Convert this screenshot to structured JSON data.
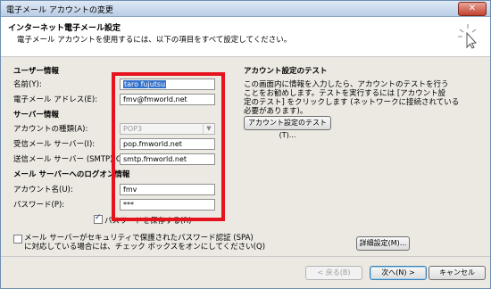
{
  "window": {
    "title": "電子メール アカウントの変更",
    "close_label": "✕"
  },
  "header": {
    "title": "インターネット電子メール設定",
    "subtitle": "電子メール アカウントを使用するには、以下の項目をすべて設定してください。"
  },
  "user_info": {
    "heading": "ユーザー情報",
    "name_label": "名前(Y):",
    "name_value": "taro fujutsu",
    "email_label": "電子メール アドレス(E):",
    "email_value": "fmv@fmworld.net"
  },
  "server_info": {
    "heading": "サーバー情報",
    "account_type_label": "アカウントの種類(A):",
    "account_type_value": "POP3",
    "incoming_label": "受信メール サーバー(I):",
    "incoming_value": "pop.fmworld.net",
    "outgoing_label": "送信メール サーバー (SMTP)(O):",
    "outgoing_value": "smtp.fmworld.net"
  },
  "logon_info": {
    "heading": "メール サーバーへのログオン情報",
    "account_name_label": "アカウント名(U):",
    "account_name_value": "fmv",
    "password_label": "パスワード(P):",
    "password_value": "***",
    "remember_label": "パスワードを保存する(R)",
    "remember_checked": true
  },
  "spa": {
    "label_line1": "メール サーバーがセキュリティで保護されたパスワード認証 (SPA)",
    "label_line2": "に対応している場合には、チェック ボックスをオンにしてください(Q)",
    "checked": false
  },
  "test": {
    "heading": "アカウント設定のテスト",
    "desc_line1": "この画面内に情報を入力したら、アカウントのテストを行う",
    "desc_line2": "ことをお勧めします。テストを実行するには [アカウント設",
    "desc_line3": "定のテスト] をクリックします (ネットワークに接続されている",
    "desc_line4": "必要があります)。",
    "button_label": "アカウント設定のテスト(T)..."
  },
  "buttons": {
    "more_settings": "詳細設定(M)...",
    "back": "< 戻る(B)",
    "next": "次へ(N) >",
    "cancel": "キャンセル"
  },
  "colors": {
    "highlight_box": "#e4131d",
    "selection": "#3370c9"
  }
}
